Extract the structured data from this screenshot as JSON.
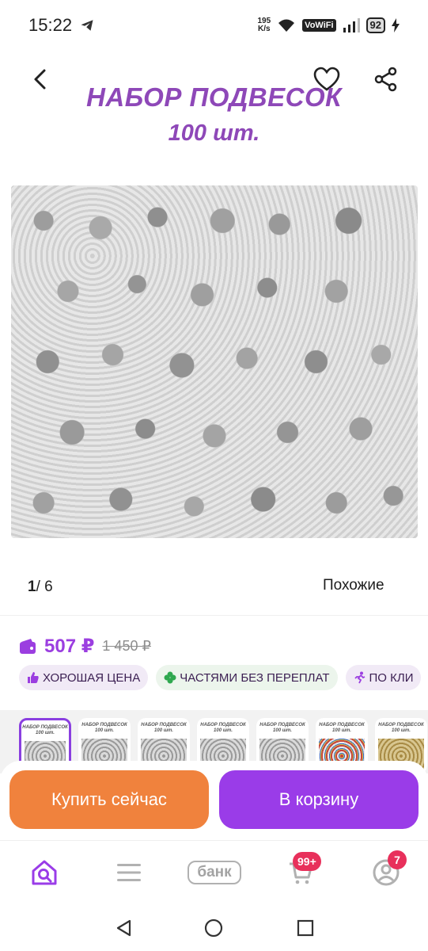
{
  "status_bar": {
    "time": "15:22",
    "net_speed_value": "195",
    "net_speed_unit": "K/s",
    "vowifi": "VoWiFi",
    "battery": "92"
  },
  "header": {
    "icons": [
      "back-icon",
      "heart-icon",
      "share-icon"
    ]
  },
  "product_image": {
    "title_line1": "НАБОР ПОДВЕСОК",
    "title_line2": "100 шт."
  },
  "pager": {
    "current": "1",
    "total": "/ 6",
    "similar_label": "Похожие"
  },
  "price": {
    "current": "507 ₽",
    "old": "1 450 ₽"
  },
  "badges": [
    {
      "label": "ХОРОШАЯ ЦЕНА",
      "icon": "thumbs-up-icon"
    },
    {
      "label": "ЧАСТЯМИ БЕЗ ПЕРЕПЛАТ",
      "icon": "clover-icon"
    },
    {
      "label": "ПО КЛИ",
      "icon": "running-person-icon"
    }
  ],
  "thumbnails": {
    "title_line1": "НАБОР ПОДВЕСОК",
    "title_line2": "100 шт.",
    "count_visible": 7
  },
  "actions": {
    "buy_now": "Купить сейчас",
    "add_to_cart": "В корзину"
  },
  "bottom_nav": {
    "bank_label": "банк",
    "cart_badge": "99+",
    "profile_badge": "7"
  },
  "colors": {
    "accent": "#9a3ce8",
    "buy_button": "#f0823d",
    "price": "#9b3ee0",
    "badge_red": "#e8305b"
  }
}
